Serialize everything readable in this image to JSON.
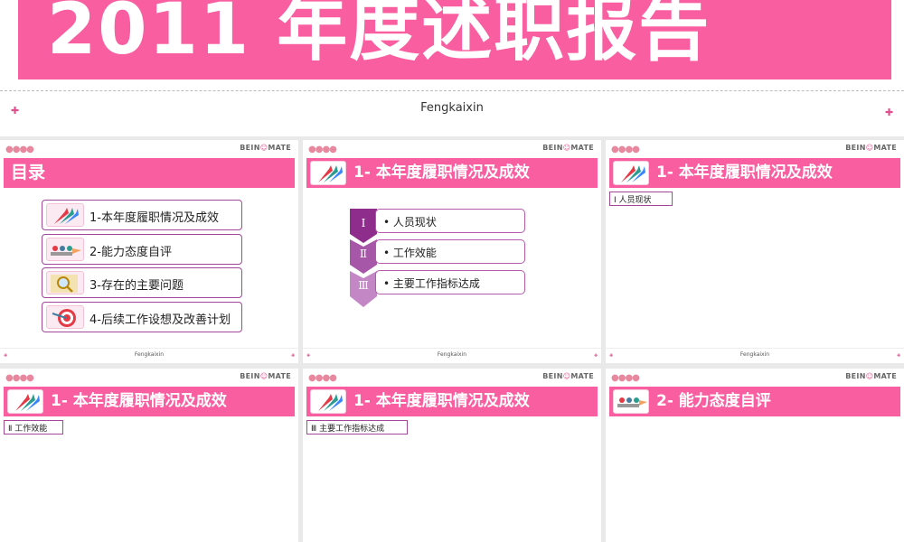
{
  "cover": {
    "title": "2011 年度述职报告",
    "author": "Fengkaixin"
  },
  "brand": {
    "logo_left": "BEIN",
    "logo_mid": "G",
    "logo_right": "MATE",
    "dots": "●●●●",
    "footer_author": "Fengkaixin"
  },
  "colors": {
    "accent_pink": "#f95ea0",
    "purple_border": "#a3479b",
    "chevron_1": "#8e2d8c",
    "chevron_2": "#a657a7",
    "chevron_3": "#c387c6"
  },
  "slides": {
    "toc": {
      "title": "目录",
      "items": [
        {
          "label": "1-本年度履职情况及成效",
          "icon": "arrows-icon"
        },
        {
          "label": "2-能力态度自评",
          "icon": "team-arrow-icon"
        },
        {
          "label": "3-存在的主要问题",
          "icon": "magnifier-icon"
        },
        {
          "label": "4-后续工作设想及改善计划",
          "icon": "target-icon"
        }
      ]
    },
    "s3": {
      "title": "1- 本年度履职情况及成效",
      "rows": [
        {
          "num": "Ⅰ",
          "text": "• 人员现状"
        },
        {
          "num": "Ⅱ",
          "text": "• 工作效能"
        },
        {
          "num": "Ⅲ",
          "text": "• 主要工作指标达成"
        }
      ]
    },
    "s4": {
      "title": "1- 本年度履职情况及成效",
      "section": "Ⅰ  人员现状"
    },
    "s5": {
      "title": "1- 本年度履职情况及成效",
      "section": "Ⅱ  工作效能"
    },
    "s6": {
      "title": "1- 本年度履职情况及成效",
      "section": "Ⅲ  主要工作指标达成"
    },
    "s7": {
      "title": "2- 能力态度自评"
    }
  }
}
